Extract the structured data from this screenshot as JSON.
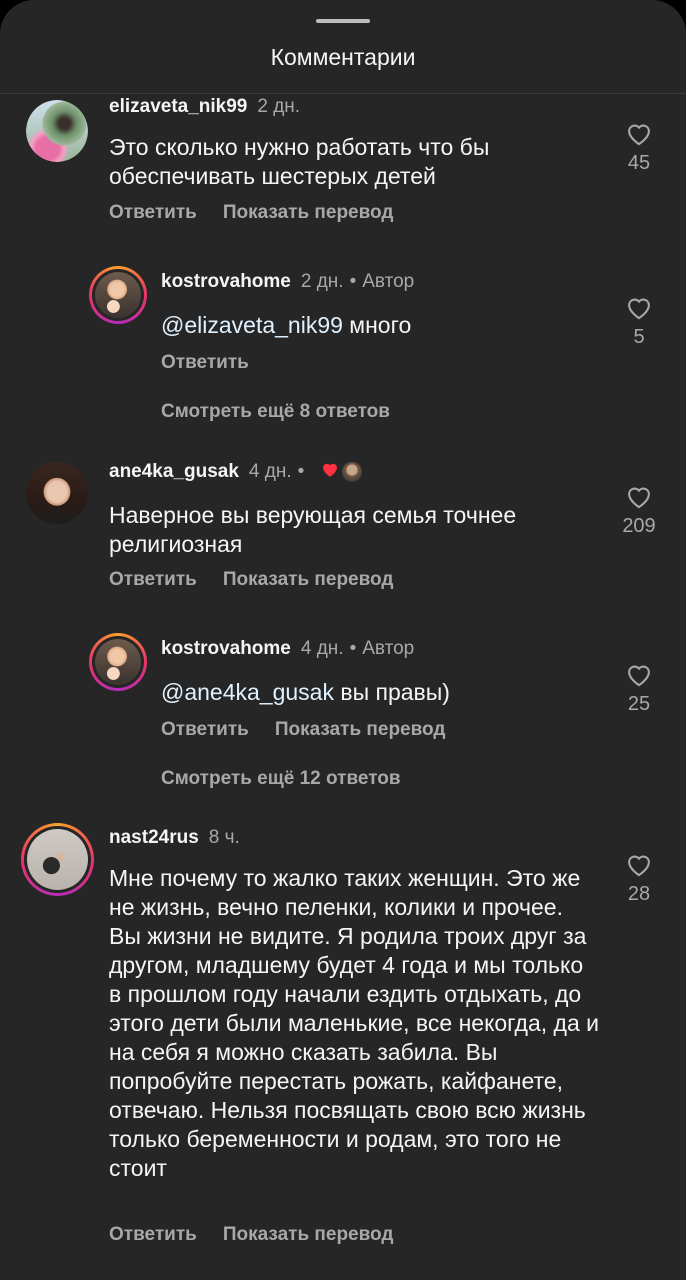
{
  "header": {
    "title": "Комментарии"
  },
  "comments": [
    {
      "username": "elizaveta_nik99",
      "time": "2 дн.",
      "text": "Это сколько нужно работать что бы обеспечивать шестерых детей",
      "likes": "45",
      "reply_label": "Ответить",
      "translate_label": "Показать перевод"
    },
    {
      "username": "kostrovahome",
      "time": "2 дн.",
      "author_label": "Автор",
      "mention": "@elizaveta_nik99",
      "text": " много",
      "likes": "5",
      "reply_label": "Ответить",
      "more_replies": "Смотреть ещё 8 ответов"
    },
    {
      "username": "ane4ka_gusak",
      "time": "4 дн.",
      "text": "Наверное вы верующая семья точнее религиозная",
      "likes": "209",
      "reply_label": "Ответить",
      "translate_label": "Показать перевод"
    },
    {
      "username": "kostrovahome",
      "time": "4 дн.",
      "author_label": "Автор",
      "mention": "@ane4ka_gusak",
      "text": " вы правы)",
      "likes": "25",
      "reply_label": "Ответить",
      "translate_label": "Показать перевод",
      "more_replies": "Смотреть ещё 12 ответов"
    },
    {
      "username": "nast24rus",
      "time": "8 ч.",
      "text": "Мне почему то жалко таких женщин. Это же не жизнь, вечно пеленки, колики и прочее. Вы жизни не видите. Я родила троих друг за другом, младшему будет 4 года и мы только в прошлом году начали ездить отдыхать, до этого дети были маленькие, все некогда, да и на себя я можно сказать забила. Вы попробуйте перестать рожать, кайфанете, отвечаю. Нельзя посвящать свою всю жизнь только беременности и родам, это того не стоит",
      "likes": "28",
      "reply_label": "Ответить",
      "translate_label": "Показать перевод"
    }
  ],
  "separator": "•",
  "icons": {
    "like": "heart-outline-icon",
    "liked_by_author": "heart-filled-icon"
  },
  "colors": {
    "background": "#262626",
    "heart_red": "#ff3040",
    "ring_start": "#f9a02a",
    "ring_end": "#b32dbc"
  }
}
